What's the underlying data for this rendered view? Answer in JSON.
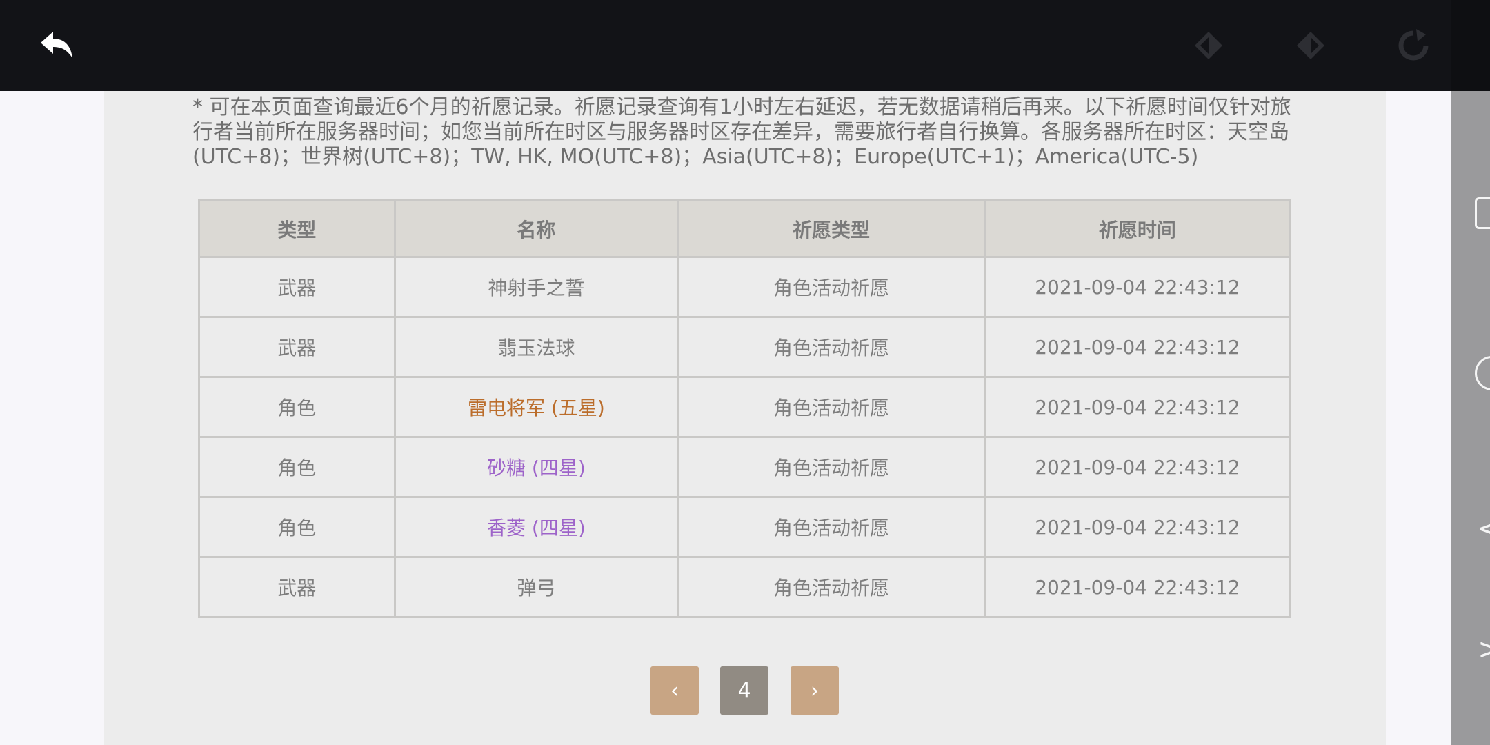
{
  "topbar": {
    "back_icon": "back-arrow-icon",
    "prev_icon": "diamond-left-icon",
    "next_icon": "diamond-right-icon",
    "reload_icon": "reload-icon"
  },
  "notice": "* 可在本页面查询最近6个月的祈愿记录。祈愿记录查询有1小时左右延迟，若无数据请稍后再来。以下祈愿时间仅针对旅行者当前所在服务器时间；如您当前所在时区与服务器时区存在差异，需要旅行者自行换算。各服务器所在时区：天空岛(UTC+8)；世界树(UTC+8)；TW, HK, MO(UTC+8)；Asia(UTC+8)；Europe(UTC+1)；America(UTC-5)",
  "table": {
    "headers": [
      "类型",
      "名称",
      "祈愿类型",
      "祈愿时间"
    ],
    "rows": [
      {
        "type": "武器",
        "name": "神射手之誓",
        "wish_type": "角色活动祈愿",
        "time": "2021-09-04 22:43:12"
      },
      {
        "type": "武器",
        "name": "翡玉法球",
        "wish_type": "角色活动祈愿",
        "time": "2021-09-04 22:43:12"
      },
      {
        "type": "角色",
        "name": "雷电将军 (五星)",
        "wish_type": "角色活动祈愿",
        "time": "2021-09-04 22:43:12"
      },
      {
        "type": "角色",
        "name": "砂糖 (四星)",
        "wish_type": "角色活动祈愿",
        "time": "2021-09-04 22:43:12"
      },
      {
        "type": "角色",
        "name": "香菱 (四星)",
        "wish_type": "角色活动祈愿",
        "time": "2021-09-04 22:43:12"
      },
      {
        "type": "武器",
        "name": "弹弓",
        "wish_type": "角色活动祈愿",
        "time": "2021-09-04 22:43:12"
      }
    ]
  },
  "pager": {
    "prev": "‹",
    "page": "4",
    "next": "›"
  },
  "colors": {
    "five_star": "#bb6d2b",
    "four_star": "#9d63c9",
    "pager_button": "#c8a584",
    "pager_current": "#918b83"
  }
}
